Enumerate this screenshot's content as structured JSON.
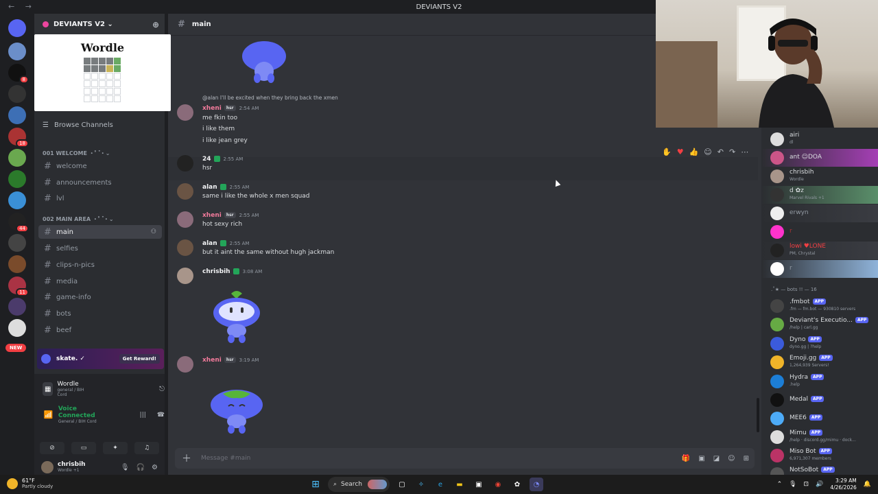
{
  "title_bar": {
    "title": "DEVIANTS V2"
  },
  "server_badges": [
    "8",
    "18",
    "44",
    "11"
  ],
  "new_label": "NEW",
  "guild": {
    "name": "DEVIANTS V2 ⌄"
  },
  "wordle_card": {
    "title": "Wordle"
  },
  "browse_channels": "Browse Channels",
  "categories": {
    "welcome": "001 WELCOME ・゜゚・⌄",
    "main_area": "002 MAIN AREA ・゜゚・⌄"
  },
  "channels": {
    "welcome": [
      "welcome",
      "announcements",
      "lvl"
    ],
    "main": [
      "main",
      "selfies",
      "clips-n-pics",
      "media",
      "game-info",
      "bots",
      "beef"
    ]
  },
  "promo": {
    "text": "skate. ✓",
    "button": "Get Reward!"
  },
  "activity": {
    "name": "Wordle",
    "sub": "general / BIH Cord"
  },
  "voice": {
    "status": "Voice Connected",
    "sub": "General / BIH Cord"
  },
  "user": {
    "name": "chrisbih",
    "status": "Wordle +1"
  },
  "chat": {
    "channel": "main",
    "composer_placeholder": "Message #main",
    "messages": [
      {
        "reply": "@alan I'll be excited when they bring back the xmen",
        "name": "xheni",
        "tag": "hsr",
        "time": "2:54 AM",
        "lines": [
          "me fkin too",
          "i like them",
          "i like jean grey"
        ]
      },
      {
        "name": "24",
        "time": "2:55 AM",
        "lines": [
          "hsr"
        ]
      },
      {
        "name": "alan",
        "time": "2:55 AM",
        "lines": [
          "same i like the whole x men squad"
        ]
      },
      {
        "name": "xheni",
        "tag": "hsr",
        "time": "2:55 AM",
        "lines": [
          "hot sexy rich"
        ]
      },
      {
        "name": "alan",
        "time": "2:55 AM",
        "lines": [
          "but it aint the same without hugh jackman"
        ]
      },
      {
        "name": "chrisbih",
        "time": "3:08 AM",
        "lines": []
      },
      {
        "name": "xheni",
        "tag": "hsr",
        "time": "3:19 AM",
        "lines": []
      }
    ]
  },
  "members": {
    "online": [
      {
        "name": "airi",
        "sub": "dl"
      },
      {
        "name": "ant ☺DOA",
        "sub": ""
      },
      {
        "name": "chrisbih",
        "sub": "Wordle"
      },
      {
        "name": "d ✿z",
        "sub": "Marvel Rivals +1"
      },
      {
        "name": "erwyn",
        "sub": ""
      },
      {
        "name": "r",
        "sub": ""
      },
      {
        "name": "lowi ♥LONE",
        "sub": "PM, Chrystal"
      },
      {
        "name": "r",
        "sub": ""
      }
    ],
    "bots_header": ".˚★ — bots !! — 16",
    "app_label": "APP",
    "bots": [
      {
        "name": ".fmbot",
        "sub": ".fm — fm.bot — 930810 servers"
      },
      {
        "name": "Deviant's Executio...",
        "sub": "/help | carl.gg"
      },
      {
        "name": "Dyno",
        "sub": "dyno.gg | ?help"
      },
      {
        "name": "Emoji.gg",
        "sub": "1,264,939 Servers!"
      },
      {
        "name": "Hydra",
        "sub": ".help"
      },
      {
        "name": "Medal",
        "sub": ""
      },
      {
        "name": "MEE6",
        "sub": ""
      },
      {
        "name": "Mimu",
        "sub": "/help · discord.gg/mimu · dock..."
      },
      {
        "name": "Miso Bot",
        "sub": "6,971,307 members"
      },
      {
        "name": "NotSoBot",
        "sub": ""
      }
    ]
  },
  "taskbar": {
    "weather_temp": "61°F",
    "weather_desc": "Partly cloudy",
    "search": "Search",
    "time": "3:29 AM",
    "date": "4/26/2026"
  }
}
